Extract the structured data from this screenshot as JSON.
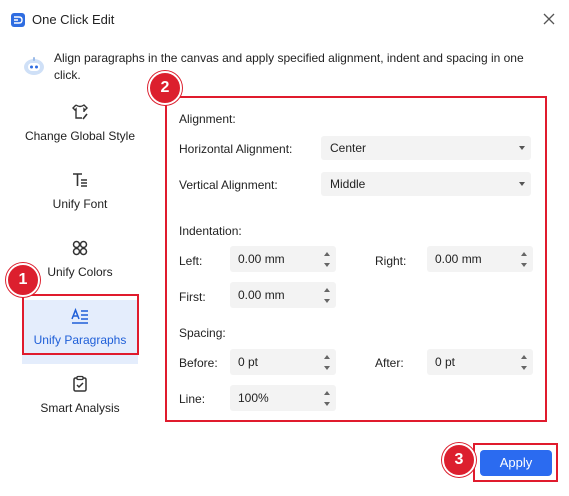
{
  "window": {
    "title": "One Click Edit",
    "icons": {
      "app": "app-logo-icon",
      "close": "close-icon"
    }
  },
  "description": {
    "text": "Align paragraphs in the canvas and apply specified alignment, indent and spacing in one click.",
    "icon": "robot-assistant-icon"
  },
  "sidebar": {
    "items": [
      {
        "label": "Change Global Style",
        "icon": "shirt-brush-icon"
      },
      {
        "label": "Unify Font",
        "icon": "text-font-icon"
      },
      {
        "label": "Unify Colors",
        "icon": "color-palette-icon"
      },
      {
        "label": "Unify Paragraphs",
        "icon": "paragraph-align-icon",
        "active": true
      },
      {
        "label": "Smart Analysis",
        "icon": "clipboard-check-icon"
      }
    ]
  },
  "panel": {
    "alignment": {
      "heading": "Alignment:",
      "horizontal_label": "Horizontal Alignment:",
      "horizontal_value": "Center",
      "vertical_label": "Vertical Alignment:",
      "vertical_value": "Middle"
    },
    "indentation": {
      "heading": "Indentation:",
      "left_label": "Left:",
      "left_value": "0.00 mm",
      "right_label": "Right:",
      "right_value": "0.00 mm",
      "first_label": "First:",
      "first_value": "0.00 mm"
    },
    "spacing": {
      "heading": "Spacing:",
      "before_label": "Before:",
      "before_value": "0 pt",
      "after_label": "After:",
      "after_value": "0 pt",
      "line_label": "Line:",
      "line_value": "100%"
    }
  },
  "apply_label": "Apply",
  "callouts": [
    "1",
    "2",
    "3"
  ],
  "colors": {
    "accent": "#2b6bf0",
    "highlight": "#e01b2d",
    "active_bg": "#e4edfc"
  }
}
